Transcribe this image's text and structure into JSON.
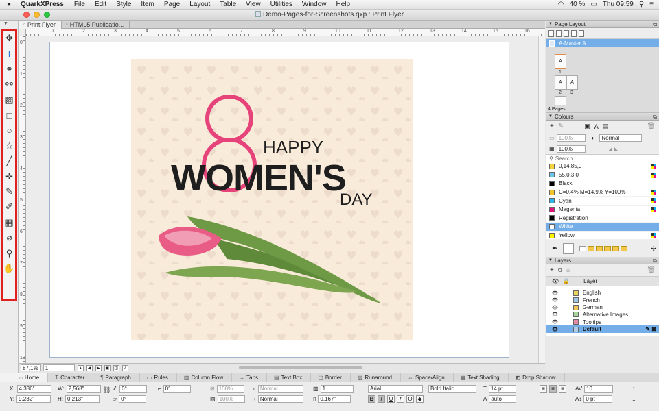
{
  "menubar": {
    "app_name": "QuarkXPress",
    "items": [
      "File",
      "Edit",
      "Style",
      "Item",
      "Page",
      "Layout",
      "Table",
      "View",
      "Utilities",
      "Window",
      "Help"
    ],
    "battery": "40 %",
    "clock": "Thu 09:59"
  },
  "window": {
    "title": "Demo-Pages-for-Screenshots.qxp : Print Flyer"
  },
  "tabs": [
    {
      "label": "Print Flyer"
    },
    {
      "label": "HTML5 Publicatio..."
    }
  ],
  "ruler": {
    "h_labels": [
      "0",
      "2",
      "3",
      "4",
      "5",
      "6",
      "7",
      "8",
      "9",
      "10",
      "11",
      "12",
      "13",
      "14",
      "15",
      "16"
    ],
    "v_labels": [
      "0",
      "1",
      "2",
      "3",
      "4",
      "5",
      "6",
      "7",
      "8",
      "9",
      "10"
    ]
  },
  "artwork": {
    "number": "8",
    "line1": "HAPPY",
    "line2": "WOMEN'S",
    "line3": "DAY",
    "colors": {
      "background": "#f9ebd9",
      "ring": "#e6437b",
      "text": "#1e1e1e",
      "heart": "#ecdfcf",
      "stem": "#5f8a3a",
      "petal": "#e85c86"
    }
  },
  "status": {
    "zoom": "87,1%",
    "page": "1"
  },
  "tools": [
    {
      "name": "item-tool-icon",
      "glyph": "✥"
    },
    {
      "name": "text-content-tool-icon",
      "glyph": "T"
    },
    {
      "name": "text-linking-tool-icon",
      "glyph": "⚭"
    },
    {
      "name": "text-unlinking-tool-icon",
      "glyph": "⚯"
    },
    {
      "name": "picture-content-tool-icon",
      "glyph": "▨"
    },
    {
      "name": "rectangle-box-tool-icon",
      "glyph": "□"
    },
    {
      "name": "oval-box-tool-icon",
      "glyph": "○"
    },
    {
      "name": "starburst-tool-icon",
      "glyph": "☆"
    },
    {
      "name": "line-tool-icon",
      "glyph": "╱"
    },
    {
      "name": "orthogonal-line-tool-icon",
      "glyph": "✛"
    },
    {
      "name": "bezier-pen-tool-icon",
      "glyph": "✎"
    },
    {
      "name": "freehand-tool-icon",
      "glyph": "✐"
    },
    {
      "name": "table-tool-icon",
      "glyph": "▦"
    },
    {
      "name": "eyedropper-tool-icon",
      "glyph": "⌀"
    },
    {
      "name": "zoom-tool-icon",
      "glyph": "⚲"
    },
    {
      "name": "pan-tool-icon",
      "glyph": "✋"
    }
  ],
  "page_layout": {
    "title": "Page Layout",
    "master": "A-Master A",
    "thumbs": [
      "A",
      "A",
      "A"
    ],
    "thumb_numbers": [
      "1",
      "2",
      "3"
    ],
    "page_count": "4 Pages"
  },
  "colours": {
    "title": "Colours",
    "tint1": "100%",
    "blend": "Normal",
    "tint2": "100%",
    "search_placeholder": "Search",
    "items": [
      {
        "name": "0,14,85,0",
        "swatch": "#f6d23c"
      },
      {
        "name": "55,0,3,0",
        "swatch": "#6cc6ea"
      },
      {
        "name": "Black",
        "swatch": "#000000"
      },
      {
        "name": "C=0.4% M=14.9% Y=100%",
        "swatch": "#f3c32a"
      },
      {
        "name": "Cyan",
        "swatch": "#29b6e8"
      },
      {
        "name": "Magenta",
        "swatch": "#e2137f"
      },
      {
        "name": "Registration",
        "swatch": "#000000"
      },
      {
        "name": "White",
        "swatch": "#ffffff"
      },
      {
        "name": "Yellow",
        "swatch": "#fff200"
      }
    ],
    "selected": "White"
  },
  "layers": {
    "title": "Layers",
    "column": "Layer",
    "items": [
      {
        "name": "English",
        "swatch": "#e8d55a"
      },
      {
        "name": "French",
        "swatch": "#9ec9ea"
      },
      {
        "name": "German",
        "swatch": "#f0c35a"
      },
      {
        "name": "Alternative Images",
        "swatch": "#a8d69a"
      },
      {
        "name": "Tooltips",
        "swatch": "#e58aa4"
      },
      {
        "name": "Default",
        "swatch": "#aecbe8"
      }
    ],
    "selected": "Default"
  },
  "measurements": {
    "tabs": [
      "Home",
      "Character",
      "Paragraph",
      "Rules",
      "Column Flow",
      "Tabs",
      "Text Box",
      "Border",
      "Runaround",
      "Space/Align",
      "Text Shading",
      "Drop Shadow"
    ],
    "x": "4,386\"",
    "y": "9,232\"",
    "w": "2,568\"",
    "h": "0,213\"",
    "angle": "0°",
    "skew": "0°",
    "corner": "0°",
    "opacity1": "100%",
    "opacity2": "100%",
    "blend1": "Normal",
    "blend2": "Normal",
    "columns": "1",
    "gutter": "0,167\"",
    "font": "Arial",
    "style": "Bold Italic",
    "size": "14 pt",
    "leading": "auto",
    "tracking": "10",
    "baseline": "0 pt"
  }
}
